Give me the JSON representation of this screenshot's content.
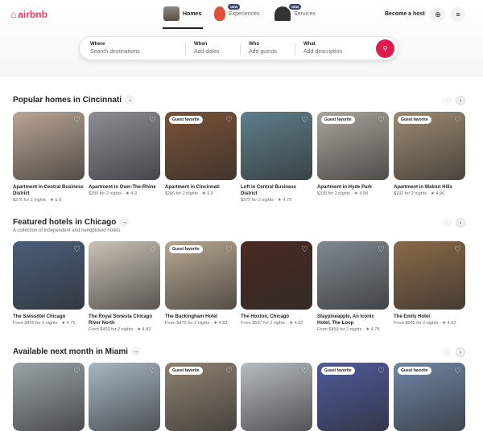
{
  "header": {
    "logo": "airbnb",
    "tabs": [
      {
        "label": "Homes",
        "icon": "house-icon"
      },
      {
        "label": "Experiences",
        "icon": "balloon-icon",
        "badge": "NEW"
      },
      {
        "label": "Services",
        "icon": "bell-icon",
        "badge": "NEW"
      }
    ],
    "become_host": "Become a host"
  },
  "search": {
    "where_label": "Where",
    "where_placeholder": "Search destinations",
    "when_label": "When",
    "when_placeholder": "Add dates",
    "who_label": "Who",
    "who_placeholder": "Add guests",
    "what_label": "What",
    "what_placeholder": "Add description"
  },
  "badge_text": "Guest favorite",
  "sections": [
    {
      "title": "Popular homes in Cincinnati",
      "subtitle": "",
      "cards": [
        {
          "title": "Apartment in Central Business District",
          "price": "$276 for 2 nights · ★ 5.0",
          "guest_favorite": false,
          "color": "#b9a594"
        },
        {
          "title": "Apartment in Over-The-Rhine",
          "price": "$289 for 2 nights · ★ 4.9",
          "guest_favorite": false,
          "color": "#8a8f95"
        },
        {
          "title": "Apartment in Cincinnati",
          "price": "$266 for 2 nights · ★ 5.0",
          "guest_favorite": true,
          "color": "#7a5236"
        },
        {
          "title": "Loft in Central Business District",
          "price": "$379 for 2 nights · ★ 4.79",
          "guest_favorite": false,
          "color": "#5e7f8a"
        },
        {
          "title": "Apartment in Hyde Park",
          "price": "$335 for 2 nights · ★ 4.98",
          "guest_favorite": true,
          "color": "#a9a49b"
        },
        {
          "title": "Apartment in Walnut Hills",
          "price": "$192 for 2 nights · ★ 4.96",
          "guest_favorite": true,
          "color": "#9c8a70"
        }
      ]
    },
    {
      "title": "Featured hotels in Chicago",
      "subtitle": "A collection of independent and handpicked hotels",
      "cards": [
        {
          "title": "The Swissôtel Chicago",
          "price": "From $409 for 2 nights · ★ 4.75",
          "guest_favorite": false,
          "color": "#4a5e7a"
        },
        {
          "title": "The Royal Sonesta Chicago River North",
          "price": "From $459 for 2 nights · ★ 4.83",
          "guest_favorite": false,
          "color": "#c9c1b5"
        },
        {
          "title": "The Buckingham Hotel",
          "price": "From $475 for 2 nights · ★ 4.83",
          "guest_favorite": true,
          "color": "#b8a890"
        },
        {
          "title": "The Hoxton, Chicago",
          "price": "From $597 for 2 nights · ★ 4.82",
          "guest_favorite": false,
          "color": "#4a2a22"
        },
        {
          "title": "Staypineapple, An Iconic Hotel, The Loop",
          "price": "From $459 for 2 nights · ★ 4.78",
          "guest_favorite": false,
          "color": "#7f8890"
        },
        {
          "title": "The Emily Hotel",
          "price": "From $645 for 2 nights · ★ 4.82",
          "guest_favorite": false,
          "color": "#8a6a48"
        }
      ]
    },
    {
      "title": "Available next month in Miami",
      "subtitle": "",
      "cards": [
        {
          "title": "",
          "price": "",
          "guest_favorite": false,
          "color": "#9aa3a8"
        },
        {
          "title": "",
          "price": "",
          "guest_favorite": false,
          "color": "#a7b6c2"
        },
        {
          "title": "",
          "price": "",
          "guest_favorite": true,
          "color": "#8f8270"
        },
        {
          "title": "",
          "price": "",
          "guest_favorite": false,
          "color": "#b6bcc0"
        },
        {
          "title": "",
          "price": "",
          "guest_favorite": true,
          "color": "#4f5a9a"
        },
        {
          "title": "",
          "price": "",
          "guest_favorite": true,
          "color": "#6f86a6"
        }
      ]
    }
  ]
}
